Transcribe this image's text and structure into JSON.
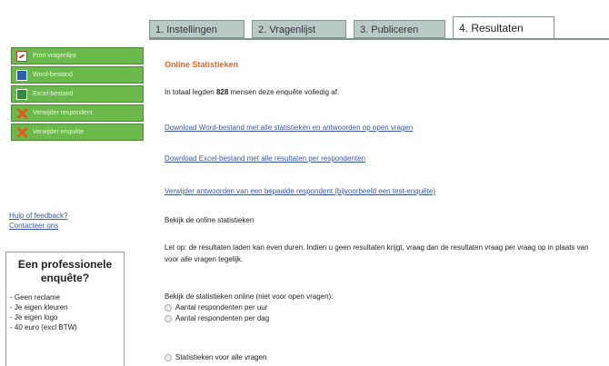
{
  "tabs": [
    {
      "label": "1. Instellingen",
      "active": false
    },
    {
      "label": "2. Vragenlijst",
      "active": false
    },
    {
      "label": "3. Publiceren",
      "active": false
    },
    {
      "label": "4. Resultaten",
      "active": true
    }
  ],
  "sidebar": {
    "buttons": [
      {
        "label": "Print vragenlijst",
        "icon": "pdf-icon"
      },
      {
        "label": "Word-bestand",
        "icon": "word-icon"
      },
      {
        "label": "Excel-bestand",
        "icon": "excel-icon"
      },
      {
        "label": "Verwijder respondent",
        "icon": "delete-icon"
      },
      {
        "label": "Verwijder enquête",
        "icon": "delete-icon"
      }
    ],
    "help_link": "Hulp of feedback?",
    "contact_link": "Contacteer ons"
  },
  "promo": {
    "title": "Een professionele enquête?",
    "items": [
      "- Geen reclame",
      "- Je eigen kleuren",
      "- Je eigen logo",
      "- 40 euro (excl BTW)"
    ]
  },
  "main": {
    "title": "Online Statistieken",
    "intro_prefix": "In totaal legden ",
    "intro_count": "828",
    "intro_suffix": " mensen deze enquête volledig af.",
    "link_word": "Download Word-bestand met alle statistieken en antwoorden op open vragen",
    "link_excel": "Download Excel-bestand met alle resultaten per respondenten",
    "link_delete": "Verwijder antwoorden van een bepaalde respondent (bijvoorbeeld een test-enquête)",
    "view_online": "Bekijk de online statistieken",
    "tip": "Let op: de resultaten laden kan even duren. Indien u geen resultaten krijgt, vraag dan de resultaten vraag per vraag op in plaats van voor alle vragen tegelijk.",
    "stats_heading": "Bekijk de statistieken online (niet voor open vragen):",
    "option_hour": "Aantal respondenten per uur",
    "option_day": "Aantal respondenten per dag",
    "option_all": "Statistieken voor alle vragen"
  },
  "colors": {
    "tab_inactive": "#b9c9c3",
    "sidebar_green": "#6bb94a",
    "title_orange": "#e8661c",
    "link_blue": "#3a56a8"
  }
}
